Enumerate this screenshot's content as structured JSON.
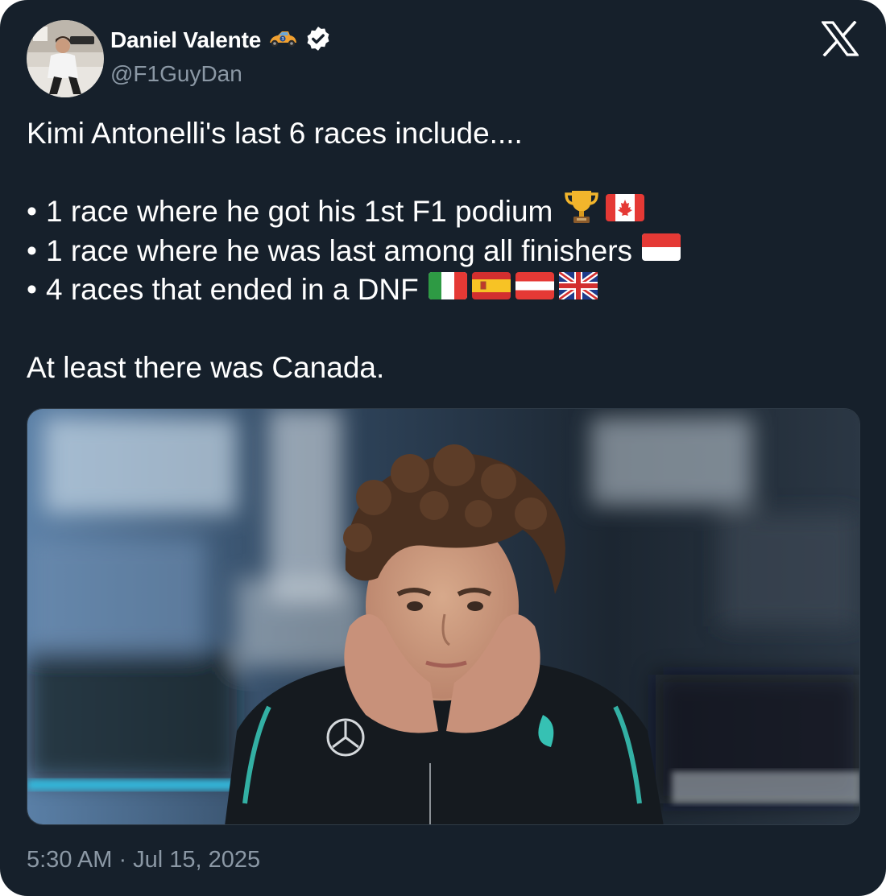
{
  "author": {
    "display_name": "Daniel Valente",
    "handle": "@F1GuyDan",
    "verified": true,
    "name_emoji": "race-car-emoji"
  },
  "tweet": {
    "intro": "Kimi Antonelli's last 6 races include....",
    "bullets": [
      {
        "bullet": "•",
        "text": "1 race where he got his 1st F1 podium",
        "emojis": [
          "trophy",
          "flag-canada"
        ]
      },
      {
        "bullet": "•",
        "text": "1 race where he was last among all finishers",
        "emojis": [
          "flag-monaco"
        ]
      },
      {
        "bullet": "•",
        "text": "4 races that ended in a DNF",
        "emojis": [
          "flag-italy",
          "flag-spain",
          "flag-austria",
          "flag-uk"
        ]
      }
    ],
    "closing": "At least there was Canada."
  },
  "media": {
    "type": "photo",
    "subject": "driver-portrait"
  },
  "meta": {
    "timestamp": "5:30 AM · Jul 15, 2025"
  },
  "colors": {
    "background": "#16202b",
    "text": "#e7e9ea",
    "secondary_text": "#8b98a5",
    "verified": "#ffffff"
  },
  "icons": {
    "brand": "x-logo-icon",
    "verified": "verified-badge-icon"
  }
}
